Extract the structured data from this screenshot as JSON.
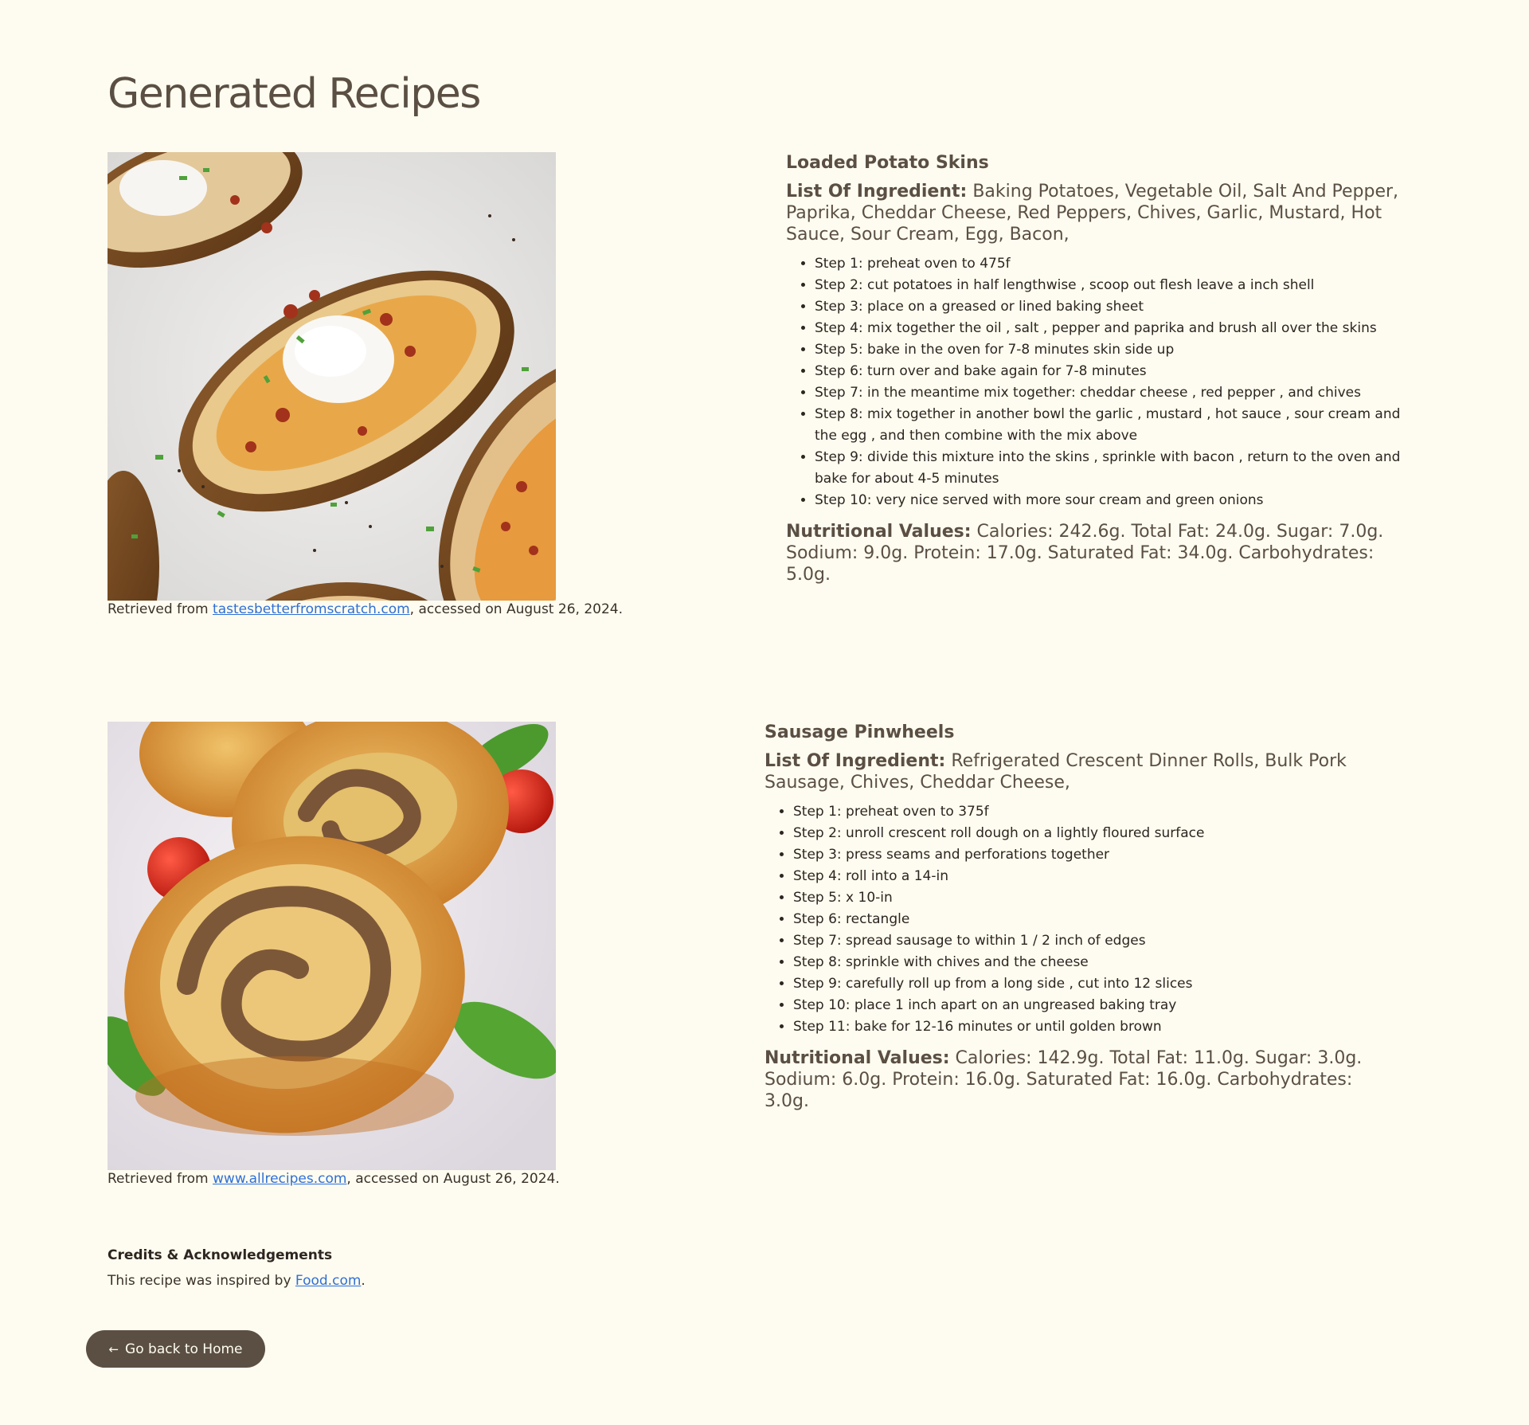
{
  "page": {
    "title": "Generated Recipes"
  },
  "recipes": [
    {
      "name": "Loaded Potato Skins",
      "ingredients_label": "List Of Ingredient:",
      "ingredients": "Baking Potatoes, Vegetable Oil, Salt And Pepper, Paprika, Cheddar Cheese, Red Peppers, Chives, Garlic, Mustard, Hot Sauce, Sour Cream, Egg, Bacon,",
      "steps": [
        "Step 1: preheat oven to 475f",
        "Step 2: cut potatoes in half lengthwise , scoop out flesh leave a inch shell",
        "Step 3: place on a greased or lined baking sheet",
        "Step 4: mix together the oil , salt , pepper and paprika and brush all over the skins",
        "Step 5: bake in the oven for 7-8 minutes skin side up",
        "Step 6: turn over and bake again for 7-8 minutes",
        "Step 7: in the meantime mix together: cheddar cheese , red pepper , and chives",
        "Step 8: mix together in another bowl the garlic , mustard , hot sauce , sour cream and the egg , and then combine with the mix above",
        "Step 9: divide this mixture into the skins , sprinkle with bacon , return to the oven and bake for about 4-5 minutes",
        "Step 10: very nice served with more sour cream and green onions"
      ],
      "nutrition_label": "Nutritional Values:",
      "nutrition": "Calories: 242.6g. Total Fat: 24.0g. Sugar: 7.0g. Sodium: 9.0g. Protein: 17.0g. Saturated Fat: 34.0g. Carbohydrates: 5.0g.",
      "caption_prefix": "Retrieved from ",
      "source_link": "tastesbetterfromscratch.com",
      "caption_suffix": ", accessed on August 26, 2024."
    },
    {
      "name": "Sausage Pinwheels",
      "ingredients_label": "List Of Ingredient:",
      "ingredients": "Refrigerated Crescent Dinner Rolls, Bulk Pork Sausage, Chives, Cheddar Cheese,",
      "steps": [
        "Step 1: preheat oven to 375f",
        "Step 2: unroll crescent roll dough on a lightly floured surface",
        "Step 3: press seams and perforations together",
        "Step 4: roll into a 14-in",
        "Step 5: x 10-in",
        "Step 6: rectangle",
        "Step 7: spread sausage to within 1 / 2 inch of edges",
        "Step 8: sprinkle with chives and the cheese",
        "Step 9: carefully roll up from a long side , cut into 12 slices",
        "Step 10: place 1 inch apart on an ungreased baking tray",
        "Step 11: bake for 12-16 minutes or until golden brown"
      ],
      "nutrition_label": "Nutritional Values:",
      "nutrition": "Calories: 142.9g. Total Fat: 11.0g. Sugar: 3.0g. Sodium: 6.0g. Protein: 16.0g. Saturated Fat: 16.0g. Carbohydrates: 3.0g.",
      "caption_prefix": "Retrieved from ",
      "source_link": "www.allrecipes.com",
      "caption_suffix": ", accessed on August 26, 2024."
    }
  ],
  "credits": {
    "title": "Credits & Acknowledgements",
    "text_prefix": "This recipe was inspired by ",
    "link": "Food.com",
    "text_suffix": "."
  },
  "back_button": {
    "arrow": "←",
    "label": "Go back to Home"
  },
  "colors": {
    "background": "#fefcf0",
    "text": "#5b4f43",
    "link": "#2f6fd6",
    "button": "#5b4f43"
  }
}
